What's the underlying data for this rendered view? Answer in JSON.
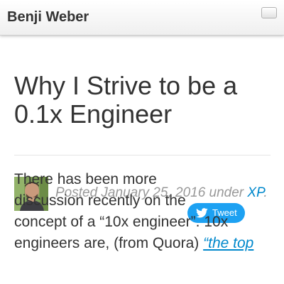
{
  "site": {
    "brand": "Benji Weber"
  },
  "post": {
    "title_line1": "Why I Strive to be a",
    "title_line2": "0.1x Engineer",
    "meta_prefix": "Posted January 25, 2016 under",
    "category": "XP",
    "meta_suffix": ".",
    "body_line1": "There has been more",
    "body_line2": "discussion recently on the",
    "body_line3": "concept of a “10x engineer”. 10x",
    "body_line4_prefix": "engineers are, (from Quora)",
    "body_line4_link": "“the top"
  },
  "share": {
    "tweet_label": "Tweet"
  },
  "icons": {
    "menu": "menu-toggle-icon",
    "tweet": "twitter-bird-icon",
    "avatar": "author-avatar-photo"
  },
  "colors": {
    "link": "#0088cc",
    "twitter": "#1da1f2",
    "meta_text": "#999999",
    "heading": "#333333"
  }
}
